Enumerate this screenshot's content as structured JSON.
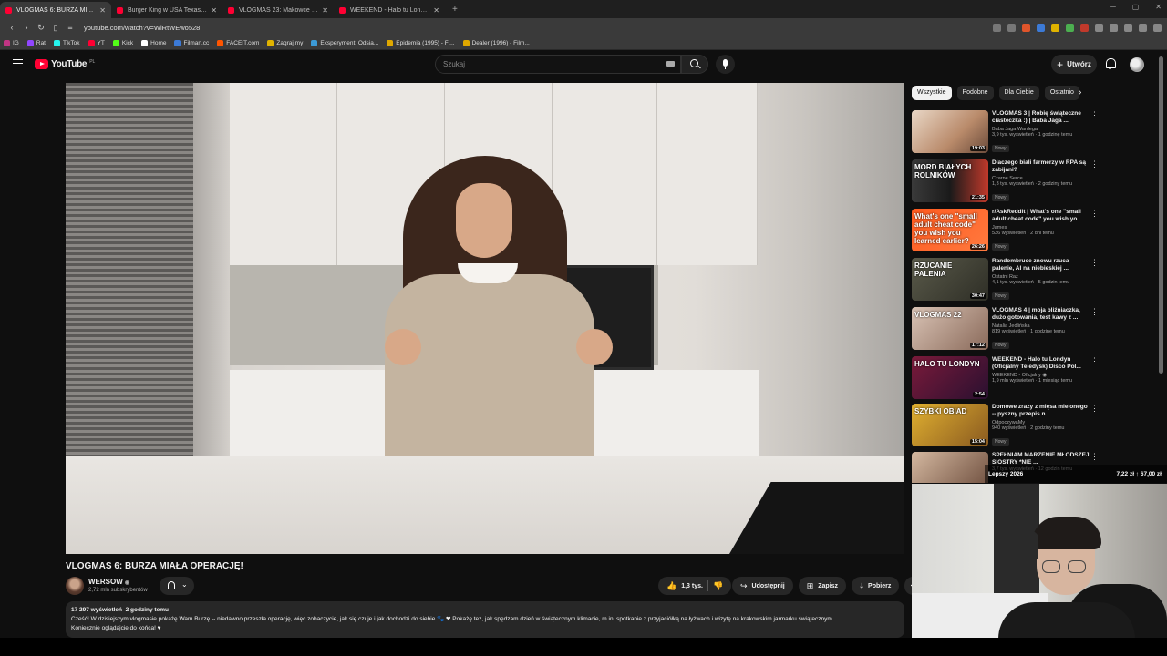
{
  "browser": {
    "tabs": [
      {
        "title": "VLOGMAS 6: BURZA MIAŁA OPERACJĘ!",
        "active": true
      },
      {
        "title": "Burger King w USA Texas 89 - YouTube",
        "active": false
      },
      {
        "title": "VLOGMAS 23: Makowce po makowi...",
        "active": false
      },
      {
        "title": "WEEKEND - Halo tu Londyn (Oficjaln...",
        "active": false
      }
    ],
    "new_tab": "+",
    "url": "youtube.com/watch?v=WiRtWEwo528",
    "bookmarks": [
      {
        "label": "IG",
        "color": "#c13584"
      },
      {
        "label": "Rat",
        "color": "#9146ff"
      },
      {
        "label": "TikTok",
        "color": "#25f4ee"
      },
      {
        "label": "YT",
        "color": "#ff0033"
      },
      {
        "label": "Kick",
        "color": "#53fc18"
      },
      {
        "label": "Home",
        "color": "#ffffff"
      },
      {
        "label": "Filman.cc",
        "color": "#3c7ad6"
      },
      {
        "label": "FACEIT.com",
        "color": "#ff5500"
      },
      {
        "label": "Zagraj.my",
        "color": "#e0b300"
      },
      {
        "label": "Eksperyment: Odsia...",
        "color": "#3c9ad6"
      },
      {
        "label": "Epidemia (1995) - Fi...",
        "color": "#e0a800"
      },
      {
        "label": "Dealer (1996) - Film...",
        "color": "#e0a800"
      }
    ]
  },
  "masthead": {
    "logo_text": "YouTube",
    "country": "PL",
    "search_placeholder": "Szukaj",
    "create_label": "Utwórz",
    "create_plus": "+"
  },
  "video": {
    "title": "VLOGMAS 6: BURZA MIAŁA OPERACJĘ!",
    "channel": "WERSOW",
    "verified": "◉",
    "subscribers": "2,72 mln subskrybentów",
    "bell_chevron": "⌄",
    "likes": "1,3 tys.",
    "like_icon": "👍",
    "dislike_icon": "👎",
    "share_label": "Udostępnij",
    "share_icon": "↪",
    "save_label": "Zapisz",
    "save_icon": "⊞",
    "download_label": "Pobierz",
    "download_icon": "⤓",
    "more": "⋯",
    "views": "17 297 wyświetleń",
    "time_ago": "2 godziny temu",
    "description_1": "Cześć! W dzisiejszym vlogmasie pokażę Wam Burzę -- niedawno przeszła operację, więc zobaczycie, jak się czuje i jak dochodzi do siebie 🐾 ❤ Pokażę też, jak spędzam dzień w świątecznym klimacie, m.in. spotkanie z przyjaciółką na łyżwach i wizytę na krakowskim jarmarku świątecznym.",
    "description_2": "Koniecznie oglądajcie do końca! ♥"
  },
  "chips": [
    "Wszystkie",
    "Podobne",
    "Dla Ciebie",
    "Ostatnio"
  ],
  "chip_next": "›",
  "recommendations": [
    {
      "title": "VLOGMAS 3 | Robię świąteczne ciasteczka :) | Baba Jaga ...",
      "channel": "Baba Jaga Wardega",
      "views": "3,9 tys. wyświetleń · 1 godzinę temu",
      "badge": "Nowy",
      "duration": "19:03",
      "thumb_text": "",
      "thumb_bg": "linear-gradient(135deg,#e9d7c6,#b98a6a 60%,#6a4a3a)"
    },
    {
      "title": "Dlaczego biali farmerzy w RPA są zabijani?",
      "channel": "Czarne Serce",
      "views": "1,3 tys. wyświetleń · 2 godziny temu",
      "badge": "Nowy",
      "duration": "21:35",
      "thumb_text": "MORD BIAŁYCH ROLNIKÓW",
      "thumb_bg": "linear-gradient(90deg,#3a3a3a,#1a1a1a 50%,#c0392b)"
    },
    {
      "title": "r/AskReddit | What's one \"small adult cheat code\" you wish yo...",
      "channel": "James",
      "views": "536 wyświetleń · 2 dni temu",
      "badge": "Nowy",
      "duration": "26:26",
      "thumb_text": "What's one \"small adult cheat code\" you wish you learned earlier?",
      "thumb_bg": "linear-gradient(135deg,#ff5a1f,#ff7a3f)"
    },
    {
      "title": "Randombruce znowu rzuca palenie, AI na niebieskiej ...",
      "channel": "Ostatni Raz",
      "views": "4,1 tys. wyświetleń · 5 godzin temu",
      "badge": "Nowy",
      "duration": "30:47",
      "thumb_text": "RZUCANIE PALENIA",
      "thumb_bg": "linear-gradient(135deg,#5a5a4a,#2e2e26)"
    },
    {
      "title": "VLOGMAS 4 | moja bliźniaczka, dużo gotowania, test kawy z ...",
      "channel": "Natalia Jedlińska",
      "views": "819 wyświetleń · 1 godzinę temu",
      "badge": "Nowy",
      "duration": "17:12",
      "thumb_text": "VLOGMAS 22",
      "thumb_bg": "linear-gradient(135deg,#d9c3b5,#8a6a5a)"
    },
    {
      "title": "WEEKEND - Halo tu Londyn (Oficjalny Teledysk) Disco Pol...",
      "channel": "WEEKEND - Oficjalny ◉",
      "views": "1,9 mln wyświetleń · 1 miesiąc temu",
      "badge": "",
      "duration": "2:54",
      "thumb_text": "HALO TU LONDYN",
      "thumb_bg": "linear-gradient(135deg,#7a1a3a,#2a1030)"
    },
    {
      "title": "Domowe zrazy z mięsa mielonego -- pyszny przepis n...",
      "channel": "OdpoczywaMy",
      "views": "940 wyświetleń · 2 godziny temu",
      "badge": "Nowy",
      "duration": "15:04",
      "thumb_text": "SZYBKI OBIAD",
      "thumb_bg": "linear-gradient(135deg,#e0b030,#8a5a20)"
    },
    {
      "title": "SPEŁNIAM MARZENIE MŁODSZEJ SIOSTRY *NIE ...",
      "channel": "",
      "views": "3,7 tys. wyświetleń · 12 godzin temu",
      "badge": "",
      "duration": "",
      "thumb_text": "",
      "thumb_bg": "linear-gradient(135deg,#d4b8a0,#6a4a3a)"
    }
  ],
  "ticker": {
    "left": "Lepszy 2026",
    "right": "7,22 zł ↑ 67,00 zł"
  }
}
